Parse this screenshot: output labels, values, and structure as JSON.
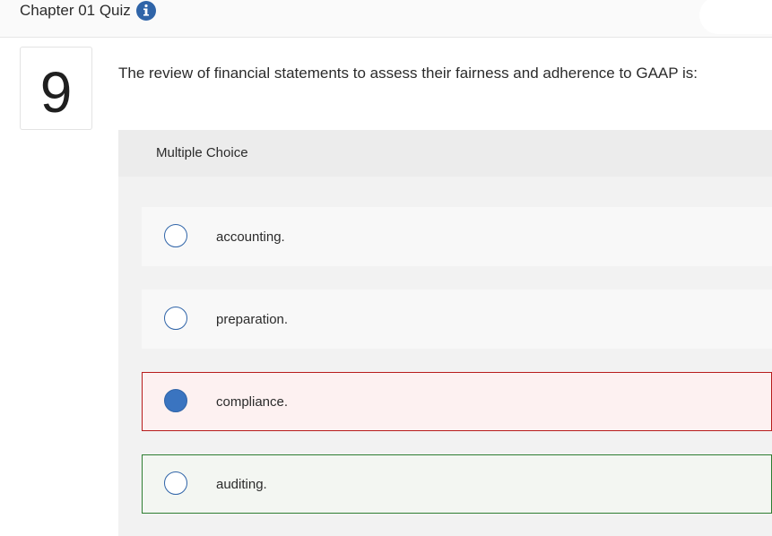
{
  "header": {
    "title": "Chapter 01 Quiz",
    "info_icon": "info-icon",
    "info_color": "#2f64a8"
  },
  "question": {
    "number": "9",
    "text": "The review of financial statements to assess their fairness and adherence to GAAP is:",
    "type_label": "Multiple Choice"
  },
  "choices": [
    {
      "label": "accounting.",
      "selected": false,
      "state": "neutral"
    },
    {
      "label": "preparation.",
      "selected": false,
      "state": "neutral"
    },
    {
      "label": "compliance.",
      "selected": true,
      "state": "incorrect"
    },
    {
      "label": "auditing.",
      "selected": false,
      "state": "correct"
    }
  ],
  "colors": {
    "incorrect_border": "#b71c1c",
    "correct_border": "#2e7d32",
    "radio_accent": "#3a74c0"
  }
}
